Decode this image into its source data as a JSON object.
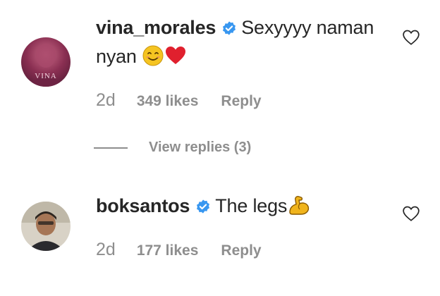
{
  "comments": [
    {
      "username": "vina_morales",
      "text_line1": "Sexyyyy naman",
      "text_line2": "nyan",
      "avatar_label": "VINA",
      "time": "2d",
      "likes": "349 likes",
      "reply": "Reply",
      "view_replies": "View replies (3)"
    },
    {
      "username": "boksantos",
      "text": "The legs",
      "time": "2d",
      "likes": "177 likes",
      "reply": "Reply"
    }
  ],
  "colors": {
    "verified": "#3897f0",
    "heart_emoji": "#e0202e",
    "smile_emoji": "#f5c421",
    "muscle_emoji": "#f0b41c",
    "muted": "#8e8e8e"
  }
}
